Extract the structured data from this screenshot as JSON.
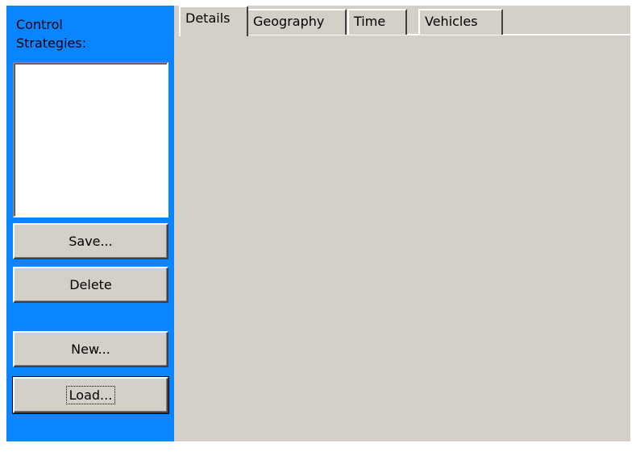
{
  "side_panel": {
    "title": "Control\nStrategies:",
    "list_items": [],
    "buttons": {
      "save": "Save...",
      "delete": "Delete",
      "new": "New...",
      "load": "Load..."
    }
  },
  "tabs": [
    {
      "label": "Details",
      "active": true
    },
    {
      "label": "Geography",
      "active": false
    },
    {
      "label": "Time",
      "active": false
    },
    {
      "label": "Vehicles",
      "active": false
    }
  ],
  "colors": {
    "panel_blue": "#0b84ff",
    "dialog_gray": "#d4d0c8"
  }
}
